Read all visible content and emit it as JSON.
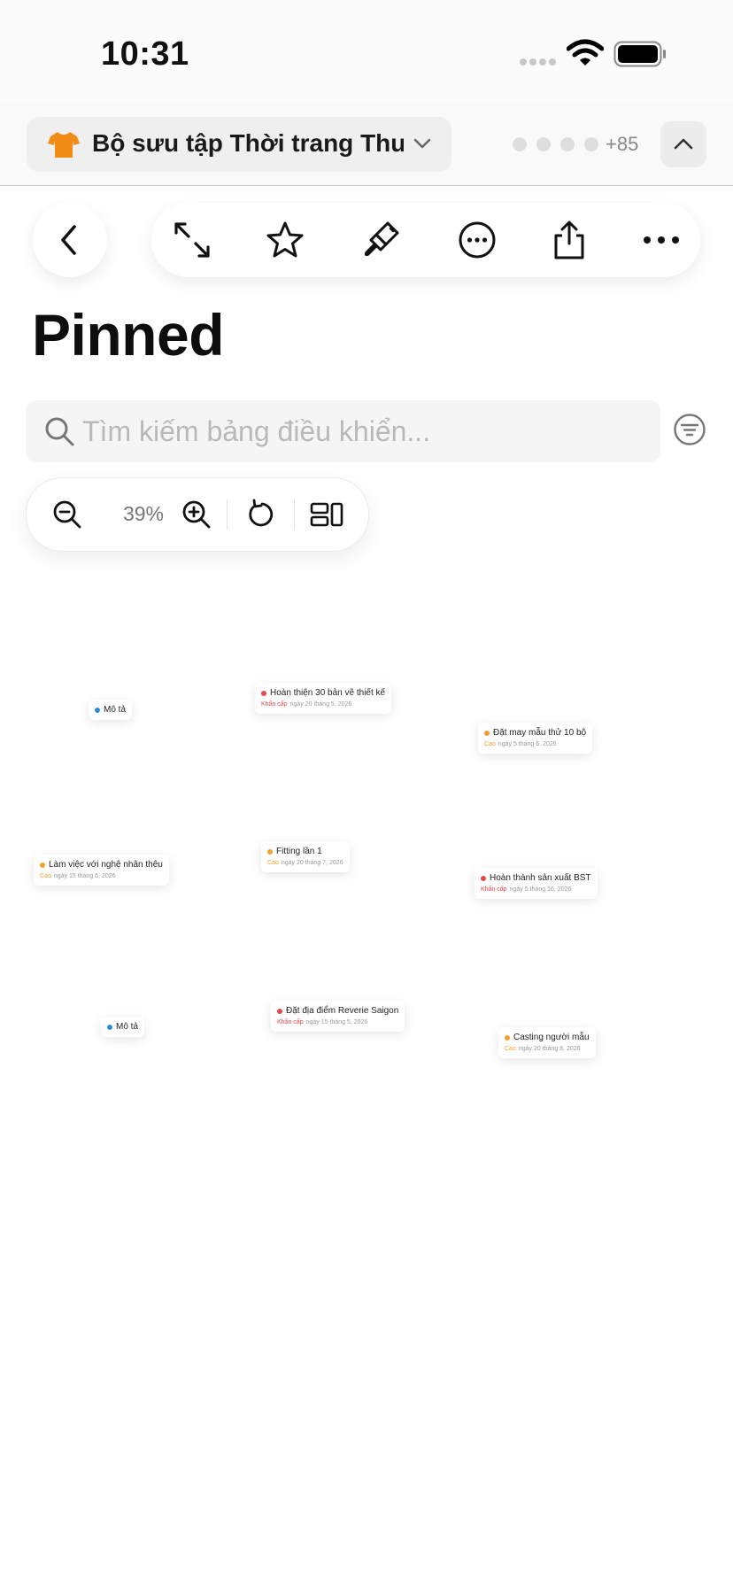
{
  "status_bar": {
    "time": "10:31"
  },
  "collection": {
    "title": "Bộ sưu tập Thời trang Thu...",
    "member_count": "+85"
  },
  "page": {
    "title": "Pinned"
  },
  "search": {
    "value": "",
    "placeholder": "Tìm kiếm bảng điều khiển..."
  },
  "zoom": {
    "level": "39%"
  },
  "colors": {
    "blue": "#2a8be0",
    "red": "#e5484d",
    "orange": "#f0a030",
    "urgent_text": "#e5484d",
    "high_text": "#f0a030",
    "shirt": "#f28c18"
  },
  "cards": [
    {
      "title": "Mô tả",
      "dot_color": "blue",
      "priority": "",
      "date": ""
    },
    {
      "title": "Hoàn thiện 30 bản vẽ thiết kế",
      "dot_color": "red",
      "priority": "Khẩn cấp",
      "date": "ngày 20 tháng 5, 2026"
    },
    {
      "title": "Đặt may mẫu thử 10 bộ",
      "dot_color": "orange",
      "priority": "Cao",
      "date": "ngày 5 tháng 6, 2026"
    },
    {
      "title": "Làm việc với nghệ nhân thêu",
      "dot_color": "orange",
      "priority": "Cao",
      "date": "ngày 15 tháng 6, 2026"
    },
    {
      "title": "Fitting lần 1",
      "dot_color": "orange",
      "priority": "Cao",
      "date": "ngày 20 tháng 7, 2026"
    },
    {
      "title": "Hoàn thành sản xuất BST",
      "dot_color": "red",
      "priority": "Khẩn cấp",
      "date": "ngày 5 tháng 10, 2026"
    },
    {
      "title": "Mô tả",
      "dot_color": "blue",
      "priority": "",
      "date": ""
    },
    {
      "title": "Đặt địa điểm Reverie Saigon",
      "dot_color": "red",
      "priority": "Khẩn cấp",
      "date": "ngày 15 tháng 5, 2026"
    },
    {
      "title": "Casting người mẫu",
      "dot_color": "orange",
      "priority": "Cao",
      "date": "ngày 20 tháng 8, 2026"
    }
  ]
}
